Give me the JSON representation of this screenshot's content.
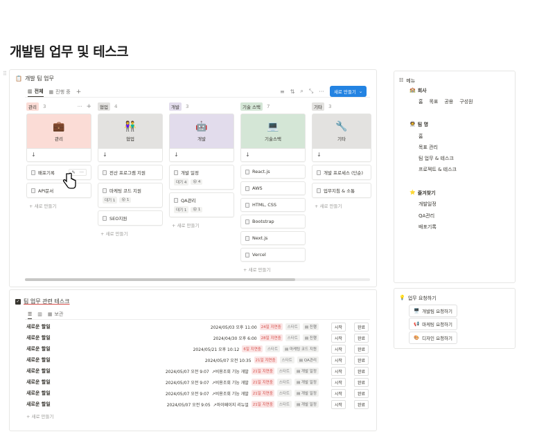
{
  "page_title": "개발팀 업무 및 테스크",
  "board": {
    "title": "개발 팀 업무",
    "tabs": [
      "전체",
      "진행 중"
    ],
    "new_button": "새로 만들기",
    "add_new": "+ 새로 만들기",
    "columns": [
      {
        "tag": "관리",
        "count": "3",
        "cover_emoji": "💼",
        "cover_label": "관리",
        "cover_bg": "#fbdcd6",
        "tag_bg": "#fbdcd6",
        "cards": [
          {
            "title": "배포기록",
            "meta": []
          },
          {
            "title": "API문서",
            "meta": []
          }
        ]
      },
      {
        "tag": "협업",
        "count": "4",
        "cover_emoji": "👫",
        "cover_label": "협업",
        "cover_bg": "#e3e2e0",
        "tag_bg": "#e3e2e0",
        "cards": [
          {
            "title": "전산 프로그램 지원",
            "meta": []
          },
          {
            "title": "마케팅 코드 지원",
            "meta": [
              "대기 1",
              "😮 1"
            ]
          },
          {
            "title": "SEO지원",
            "meta": []
          }
        ]
      },
      {
        "tag": "개발",
        "count": "3",
        "cover_emoji": "🤖",
        "cover_label": "개발",
        "cover_bg": "#e2dcec",
        "tag_bg": "#e2dcec",
        "cards": [
          {
            "title": "개발 일정",
            "meta": [
              "대기 4",
              "😮 4"
            ]
          },
          {
            "title": "QA관리",
            "meta": [
              "대기 1",
              "😮 1"
            ]
          }
        ]
      },
      {
        "tag": "기술 스택",
        "count": "7",
        "cover_emoji": "💻",
        "cover_label": "기술스택",
        "cover_bg": "#d4e6d6",
        "tag_bg": "#d4e6d6",
        "cards": [
          {
            "title": "React.js",
            "meta": []
          },
          {
            "title": "AWS",
            "meta": []
          },
          {
            "title": "HTML, CSS",
            "meta": []
          },
          {
            "title": "Bootstrap",
            "meta": []
          },
          {
            "title": "Next.js",
            "meta": []
          },
          {
            "title": "Vercel",
            "meta": []
          }
        ]
      },
      {
        "tag": "기타",
        "count": "3",
        "cover_emoji": "🔧",
        "cover_label": "기타",
        "cover_bg": "#e3e2e0",
        "tag_bg": "#e3e2e0",
        "cards": [
          {
            "title": "개발 프로세스 (단순)",
            "meta": []
          },
          {
            "title": "업무지침 & 소통",
            "meta": []
          }
        ]
      }
    ]
  },
  "tasks": {
    "title": "팀 업무 관련 테스크",
    "tab_board": "보관",
    "add_new": "+ 새로 만들기",
    "rows": [
      {
        "name": "새로운 할일",
        "date": "2024/05/03 오후 11:00",
        "days": "24일 지연중",
        "status": "스타트",
        "chip": "진행",
        "a": "시작",
        "b": "완료"
      },
      {
        "name": "새로운 할일",
        "date": "2024/04/30 오후 6:00",
        "days": "28일 지연중",
        "status": "스타트",
        "chip": "진행",
        "a": "시작",
        "b": "완료"
      },
      {
        "name": "새로운 할일",
        "date": "2024/05/21 오후 10:12",
        "days": "6일 지연중",
        "status": "스타트",
        "chip": "마케팅 코드 지원",
        "a": "시작",
        "b": "완료"
      },
      {
        "name": "새로운 할일",
        "date": "2024/05/07 오전 10:35",
        "days": "21일 지연중",
        "status": "스타트",
        "chip": "QA관리",
        "a": "시작",
        "b": "완료"
      },
      {
        "name": "새로운 할일",
        "date": "2024/05/07 오전 9:07",
        "link": "비용조회 기능 개발",
        "days": "21일 지연중",
        "status": "스타트",
        "chip": "개발 일정",
        "a": "시작",
        "b": "완료"
      },
      {
        "name": "새로운 할일",
        "date": "2024/05/07 오전 9:07",
        "link": "비용조회 기능 개발",
        "days": "21일 지연중",
        "status": "스타트",
        "chip": "개발 일정",
        "a": "시작",
        "b": "완료"
      },
      {
        "name": "새로운 할일",
        "date": "2024/05/07 오전 9:07",
        "link": "비용조회 기능 개발",
        "days": "21일 지연중",
        "status": "스타트",
        "chip": "개발 일정",
        "a": "시작",
        "b": "완료"
      },
      {
        "name": "새로운 할일",
        "date": "2024/05/07 오전 9:05",
        "link": "마이페이지 리뉴얼",
        "days": "21일 지연중",
        "status": "스타트",
        "chip": "개발 일정",
        "a": "시작",
        "b": "완료"
      }
    ]
  },
  "sidebar": {
    "menu_label": "메뉴",
    "company": "회사",
    "company_links": [
      "홈",
      "목표",
      "공용",
      "구성원"
    ],
    "team": "팀 명",
    "team_links": [
      "홈",
      "목표 관리",
      "팀 업무 & 테스크",
      "프로젝트 & 테스크"
    ],
    "favorites": "즐겨찾기",
    "fav_links": [
      "개발일정",
      "QA관리",
      "배포기록"
    ],
    "request": "업무 요청하기",
    "request_buttons": [
      "개발팀 요청하기",
      "마케팅 요청하기",
      "디자인 요청하기"
    ]
  }
}
